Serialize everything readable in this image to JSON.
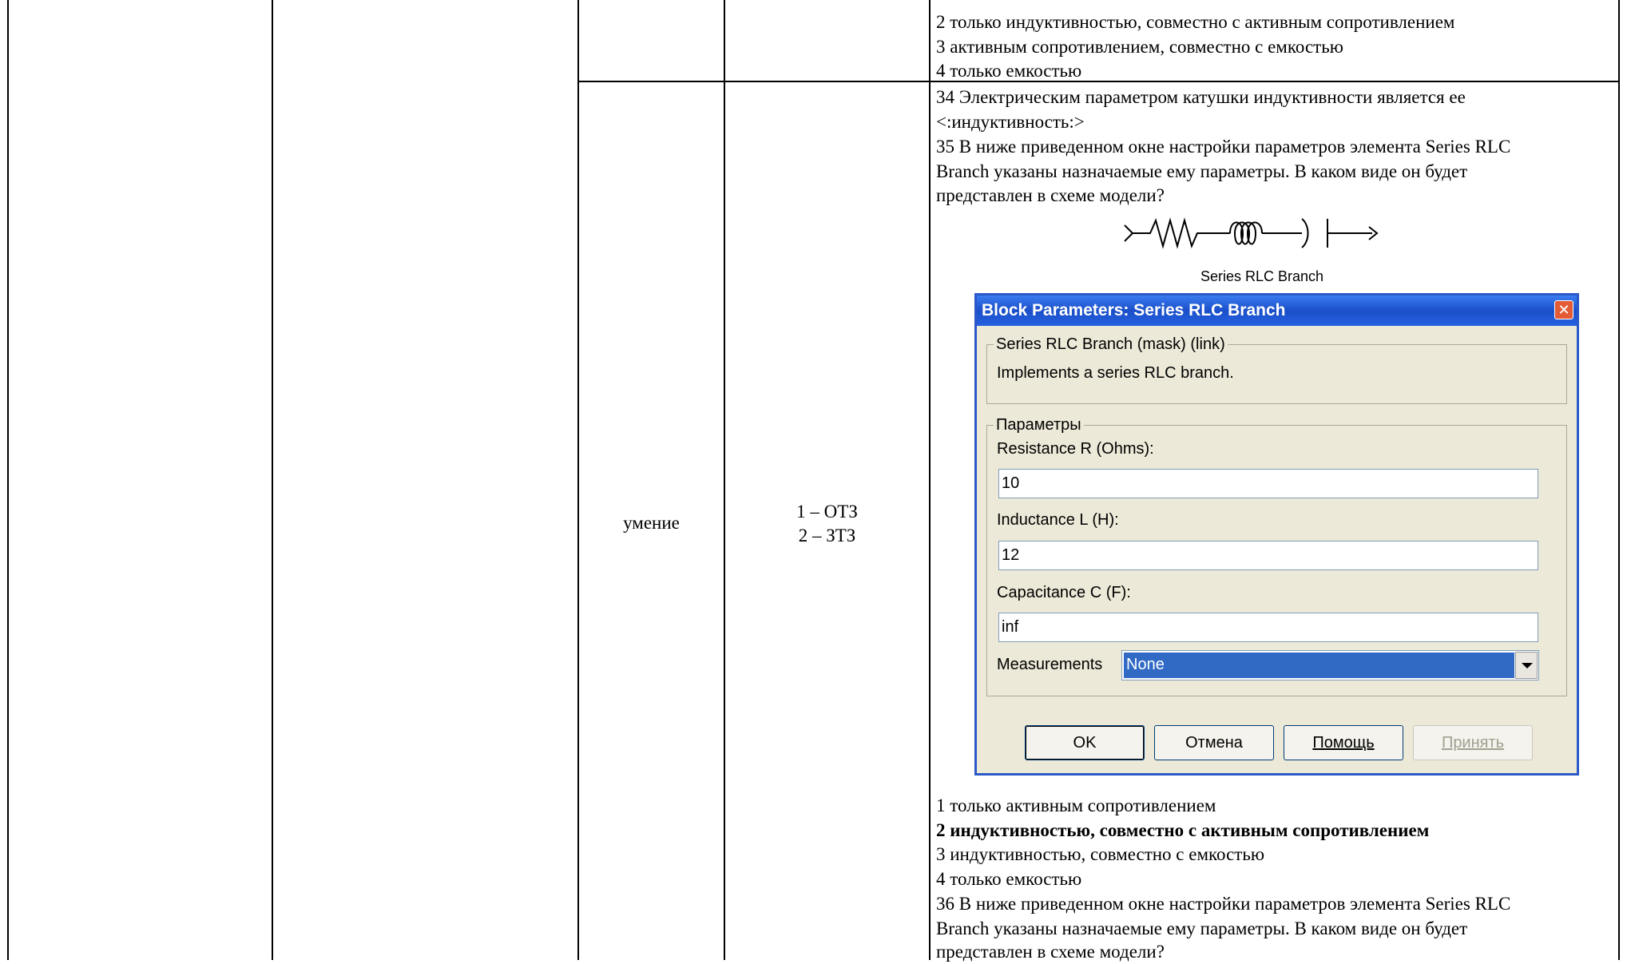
{
  "table": {
    "row2_col3": "умение",
    "row2_col4_line1": "1 – ОТЗ",
    "row2_col4_line2": "2 – ЗТЗ"
  },
  "prev_question_options": [
    "2  только индуктивностью, совместно с активным сопротивлением",
    "3  активным сопротивлением, совместно с емкостью",
    "4  только емкостью"
  ],
  "q34": {
    "line1": " 34 Электрическим параметром катушки индуктивности является ее",
    "line2": "<:индуктивность:>"
  },
  "q35": {
    "line1": "35 В ниже приведенном окне настройки параметров элемента Series RLC",
    "line2": "Branch указаны назначаемые ему параметры. В каком виде он будет",
    "line3": "представлен в схеме модели?",
    "options": [
      " 1  только активным сопротивлением",
      " 2  индуктивностью, совместно с активным сопротивлением",
      " 3  индуктивностью, совместно с емкостью",
      " 4  только емкостью"
    ]
  },
  "q36": {
    "line1": " 36 В ниже приведенном окне настройки параметров элемента Series RLC",
    "line2": "Branch указаны назначаемые ему параметры. В каком виде он будет",
    "line3": "представлен в схеме модели?"
  },
  "symbol": {
    "caption": "Series RLC Branch"
  },
  "dialog": {
    "title": "Block Parameters: Series RLC Branch",
    "close_glyph": "✕",
    "mask_group_label": "Series RLC Branch (mask) (link)",
    "description": "Implements a series RLC branch.",
    "params_group_label": "Параметры",
    "resistance_label": "Resistance R (Ohms):",
    "resistance_value": "10",
    "inductance_label": "Inductance L (H):",
    "inductance_value": "12",
    "capacitance_label": "Capacitance C (F):",
    "capacitance_value": "inf",
    "measurements_label": "Measurements",
    "measurements_value": "None",
    "ok_label": "OK",
    "cancel_label": "Отмена",
    "help_label": "Помощь",
    "apply_label": "Принять"
  },
  "colors": {
    "dialog_border": "#2b59c8",
    "dialog_bg": "#ece9d8",
    "selection": "#316ac5"
  }
}
